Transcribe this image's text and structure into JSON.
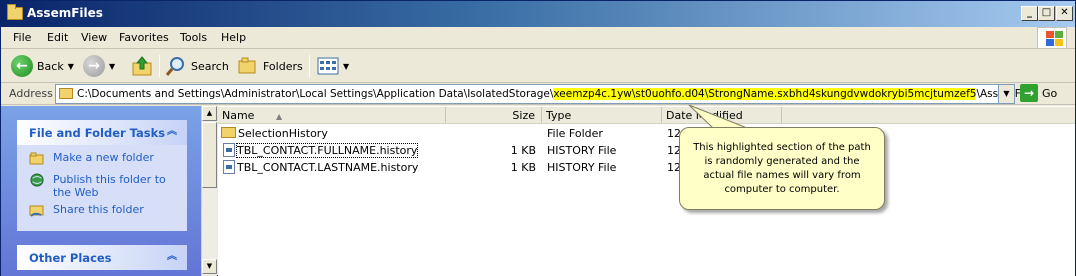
{
  "window": {
    "title": "AssemFiles",
    "minimize": "_",
    "maximize": "□",
    "close": "✕"
  },
  "menu": [
    "File",
    "Edit",
    "View",
    "Favorites",
    "Tools",
    "Help"
  ],
  "toolbar": {
    "back": "Back",
    "search": "Search",
    "folders": "Folders"
  },
  "address": {
    "label": "Address",
    "prefix": "C:\\Documents and Settings\\Administrator\\Local Settings\\Application Data\\IsolatedStorage\\",
    "highlight": "xeemzp4c.1yw\\st0uohfo.d04\\StrongName.sxbhd4skungdvwdokrybi5mcjtumzef5",
    "suffix": "\\AssemFiles",
    "go": "Go"
  },
  "tasks": {
    "file_folder_title": "File and Folder Tasks",
    "items": [
      "Make a new folder",
      "Publish this folder to the Web",
      "Share this folder"
    ],
    "other_places_title": "Other Places"
  },
  "columns": {
    "name": "Name",
    "size": "Size",
    "type": "Type",
    "date": "Date Modified"
  },
  "files": [
    {
      "name": "SelectionHistory",
      "size": "",
      "type": "File Folder",
      "date": "12/"
    },
    {
      "name": "TBL_CONTACT.FULLNAME.history",
      "size": "1 KB",
      "type": "HISTORY File",
      "date": "12/"
    },
    {
      "name": "TBL_CONTACT.LASTNAME.history",
      "size": "1 KB",
      "type": "HISTORY File",
      "date": "12/"
    }
  ],
  "callout": {
    "text": "This highlighted section of the path is randomly generated and the actual file names will vary from computer to computer."
  },
  "icons": {
    "back": "back-arrow-icon",
    "forward": "forward-arrow-icon",
    "up": "up-folder-icon",
    "search": "magnifier-icon",
    "folders": "folders-icon",
    "views": "views-icon"
  }
}
